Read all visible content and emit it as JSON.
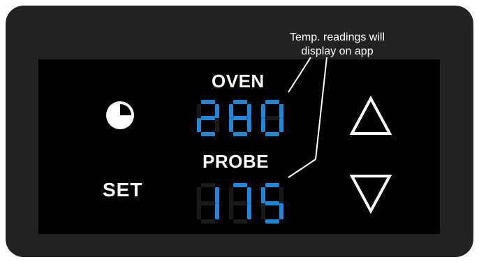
{
  "callout": {
    "line1": "Temp. readings will",
    "line2": "display on app"
  },
  "labels": {
    "oven": "OVEN",
    "probe": "PROBE",
    "set": "SET"
  },
  "oven_reading": "280",
  "probe_reading": "175",
  "colors": {
    "panel": "#222222",
    "screen": "#000000",
    "digit_on": "#1e88d8",
    "digit_off": "#1a1a1a",
    "text": "#ffffff"
  },
  "icons": {
    "timer": "timer-icon",
    "up": "up-arrow-icon",
    "down": "down-arrow-icon"
  }
}
